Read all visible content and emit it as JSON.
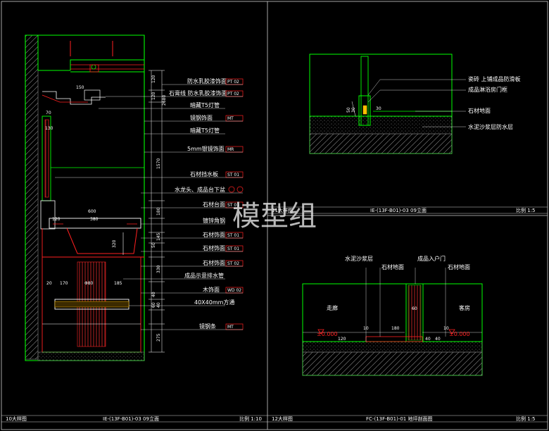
{
  "left_detail": {
    "labels": [
      {
        "text": "防水乳胶漆饰面",
        "code": "PT 02"
      },
      {
        "text": "石膏线 防水乳胶漆饰面",
        "code": "PT 02"
      },
      {
        "text": "暗藏T5灯管",
        "code": ""
      },
      {
        "text": "镜钢饰面",
        "code": "MT"
      },
      {
        "text": "暗藏T5灯管",
        "code": ""
      },
      {
        "text": "5mm银镜饰面",
        "code": "MR"
      },
      {
        "text": "石材挡水板",
        "code": "ST 01"
      },
      {
        "text": "水龙头、成品台下盆",
        "code": ""
      },
      {
        "text": "石材台面",
        "code": "ST 01"
      },
      {
        "text": "镀锌角钢",
        "code": ""
      },
      {
        "text": "石材饰面",
        "code": "ST 01"
      },
      {
        "text": "石材饰面",
        "code": "ST 01"
      },
      {
        "text": "石材饰面",
        "code": "ST 02"
      },
      {
        "text": "成品示意排水管",
        "code": ""
      },
      {
        "text": "木饰面",
        "code": "WD 02"
      },
      {
        "text": "40X40mm方通",
        "code": ""
      },
      {
        "text": "镜钢条",
        "code": "MT"
      }
    ],
    "dims_vertical": [
      "120",
      "120",
      "2680",
      "1570",
      "180",
      "145",
      "50",
      "320",
      "330",
      "40",
      "60",
      "40",
      "275"
    ],
    "dims_horizontal": [
      "150",
      "70",
      "130",
      "600",
      "380",
      "120",
      "20",
      "170",
      "Φ80",
      "185"
    ]
  },
  "top_right_detail": {
    "labels": [
      "瓷砖 上铺成品防滑板",
      "成品淋浴房门框",
      "石材地面",
      "水泥沙浆层防水层"
    ],
    "dims": [
      "30",
      "50",
      "30"
    ]
  },
  "bottom_right_detail": {
    "labels_top": [
      "水泥沙浆层",
      "石材地面",
      "成品入户门",
      "石材地面"
    ],
    "room_left": "走廊",
    "room_right": "客房",
    "level_left": "±0.000",
    "level_right": "±0.000",
    "dims": [
      "10",
      "180",
      "10",
      "120",
      "60",
      "40",
      "40"
    ]
  },
  "title_bars": [
    {
      "num": "10大样图",
      "drawing": "IE-(13F-B01)-03   09立面",
      "scale": "比例 1:10"
    },
    {
      "num": "11大样图",
      "drawing": "IE-(13F-B01)-03   09立面",
      "scale": "比例 1:5"
    },
    {
      "num": "12大样图",
      "drawing": "FC-(13F-B01)-01   地坪剖面图",
      "scale": "比例 1:5"
    }
  ],
  "watermark": "模型组",
  "colors": {
    "background": "#000000",
    "green": "#00ff00",
    "red": "#ff2020",
    "white": "#ffffff",
    "gray": "#7a7a7a"
  }
}
